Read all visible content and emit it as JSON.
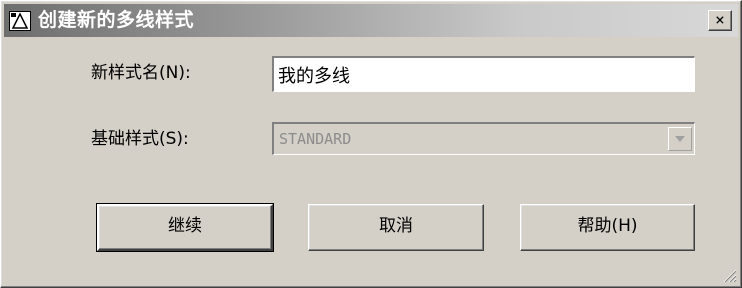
{
  "window": {
    "title": "创建新的多线样式",
    "close_glyph": "×"
  },
  "form": {
    "name_label": "新样式名(N):",
    "name_value": "我的多线",
    "base_label": "基础样式(S):",
    "base_value": "STANDARD"
  },
  "buttons": {
    "continue": "继续",
    "cancel": "取消",
    "help": "帮助(H)"
  },
  "icons": {
    "title_icon": "autocad-app-icon",
    "close": "close-icon",
    "dropdown": "chevron-down-icon",
    "resize": "resize-grip-icon"
  }
}
